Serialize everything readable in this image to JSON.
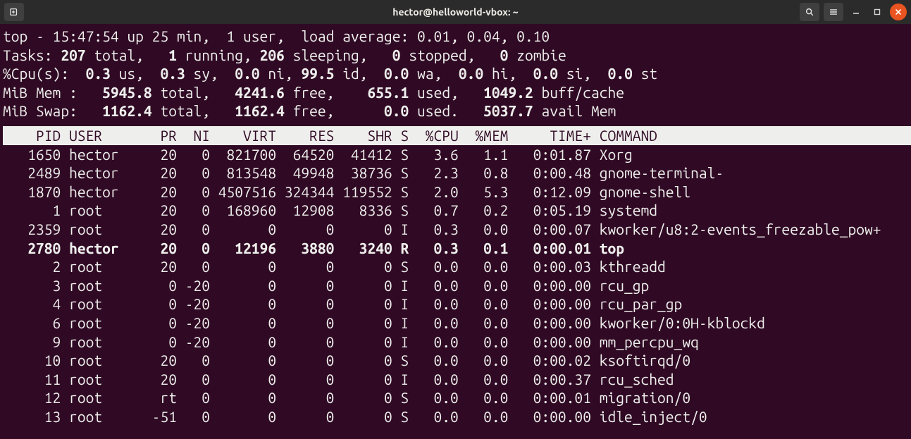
{
  "window": {
    "title": "hector@helloworld-vbox: ~"
  },
  "top": {
    "time": "15:47:54",
    "uptime": "25 min",
    "users": "1 user",
    "load": "0.01, 0.04, 0.10",
    "tasks": {
      "total": "207",
      "running": "1",
      "sleeping": "206",
      "stopped": "0",
      "zombie": "0"
    },
    "cpu": {
      "us": "0.3",
      "sy": "0.3",
      "ni": "0.0",
      "id": "99.5",
      "wa": "0.0",
      "hi": "0.0",
      "si": "0.0",
      "st": "0.0"
    },
    "mem": {
      "total": "5945.8",
      "free": "4241.6",
      "used": "655.1",
      "buff": "1049.2"
    },
    "swap": {
      "total": "1162.4",
      "free": "1162.4",
      "used": "0.0",
      "avail": "5037.7"
    }
  },
  "columns": [
    "PID",
    "USER",
    "PR",
    "NI",
    "VIRT",
    "RES",
    "SHR",
    "S",
    "%CPU",
    "%MEM",
    "TIME+",
    "COMMAND"
  ],
  "processes": [
    {
      "pid": "1650",
      "user": "hector",
      "pr": "20",
      "ni": "0",
      "virt": "821700",
      "res": "64520",
      "shr": "41412",
      "s": "S",
      "cpu": "3.6",
      "mem": "1.1",
      "time": "0:01.87",
      "cmd": "Xorg",
      "bold": false
    },
    {
      "pid": "2489",
      "user": "hector",
      "pr": "20",
      "ni": "0",
      "virt": "813548",
      "res": "49948",
      "shr": "38736",
      "s": "S",
      "cpu": "2.3",
      "mem": "0.8",
      "time": "0:00.48",
      "cmd": "gnome-terminal-",
      "bold": false
    },
    {
      "pid": "1870",
      "user": "hector",
      "pr": "20",
      "ni": "0",
      "virt": "4507516",
      "res": "324344",
      "shr": "119552",
      "s": "S",
      "cpu": "2.0",
      "mem": "5.3",
      "time": "0:12.09",
      "cmd": "gnome-shell",
      "bold": false
    },
    {
      "pid": "1",
      "user": "root",
      "pr": "20",
      "ni": "0",
      "virt": "168960",
      "res": "12908",
      "shr": "8336",
      "s": "S",
      "cpu": "0.7",
      "mem": "0.2",
      "time": "0:05.19",
      "cmd": "systemd",
      "bold": false
    },
    {
      "pid": "2359",
      "user": "root",
      "pr": "20",
      "ni": "0",
      "virt": "0",
      "res": "0",
      "shr": "0",
      "s": "I",
      "cpu": "0.3",
      "mem": "0.0",
      "time": "0:00.07",
      "cmd": "kworker/u8:2-events_freezable_pow+",
      "bold": false
    },
    {
      "pid": "2780",
      "user": "hector",
      "pr": "20",
      "ni": "0",
      "virt": "12196",
      "res": "3880",
      "shr": "3240",
      "s": "R",
      "cpu": "0.3",
      "mem": "0.1",
      "time": "0:00.01",
      "cmd": "top",
      "bold": true
    },
    {
      "pid": "2",
      "user": "root",
      "pr": "20",
      "ni": "0",
      "virt": "0",
      "res": "0",
      "shr": "0",
      "s": "S",
      "cpu": "0.0",
      "mem": "0.0",
      "time": "0:00.03",
      "cmd": "kthreadd",
      "bold": false
    },
    {
      "pid": "3",
      "user": "root",
      "pr": "0",
      "ni": "-20",
      "virt": "0",
      "res": "0",
      "shr": "0",
      "s": "I",
      "cpu": "0.0",
      "mem": "0.0",
      "time": "0:00.00",
      "cmd": "rcu_gp",
      "bold": false
    },
    {
      "pid": "4",
      "user": "root",
      "pr": "0",
      "ni": "-20",
      "virt": "0",
      "res": "0",
      "shr": "0",
      "s": "I",
      "cpu": "0.0",
      "mem": "0.0",
      "time": "0:00.00",
      "cmd": "rcu_par_gp",
      "bold": false
    },
    {
      "pid": "6",
      "user": "root",
      "pr": "0",
      "ni": "-20",
      "virt": "0",
      "res": "0",
      "shr": "0",
      "s": "I",
      "cpu": "0.0",
      "mem": "0.0",
      "time": "0:00.00",
      "cmd": "kworker/0:0H-kblockd",
      "bold": false
    },
    {
      "pid": "9",
      "user": "root",
      "pr": "0",
      "ni": "-20",
      "virt": "0",
      "res": "0",
      "shr": "0",
      "s": "I",
      "cpu": "0.0",
      "mem": "0.0",
      "time": "0:00.00",
      "cmd": "mm_percpu_wq",
      "bold": false
    },
    {
      "pid": "10",
      "user": "root",
      "pr": "20",
      "ni": "0",
      "virt": "0",
      "res": "0",
      "shr": "0",
      "s": "S",
      "cpu": "0.0",
      "mem": "0.0",
      "time": "0:00.02",
      "cmd": "ksoftirqd/0",
      "bold": false
    },
    {
      "pid": "11",
      "user": "root",
      "pr": "20",
      "ni": "0",
      "virt": "0",
      "res": "0",
      "shr": "0",
      "s": "I",
      "cpu": "0.0",
      "mem": "0.0",
      "time": "0:00.37",
      "cmd": "rcu_sched",
      "bold": false
    },
    {
      "pid": "12",
      "user": "root",
      "pr": "rt",
      "ni": "0",
      "virt": "0",
      "res": "0",
      "shr": "0",
      "s": "S",
      "cpu": "0.0",
      "mem": "0.0",
      "time": "0:00.01",
      "cmd": "migration/0",
      "bold": false
    },
    {
      "pid": "13",
      "user": "root",
      "pr": "-51",
      "ni": "0",
      "virt": "0",
      "res": "0",
      "shr": "0",
      "s": "S",
      "cpu": "0.0",
      "mem": "0.0",
      "time": "0:00.00",
      "cmd": "idle_inject/0",
      "bold": false
    }
  ]
}
